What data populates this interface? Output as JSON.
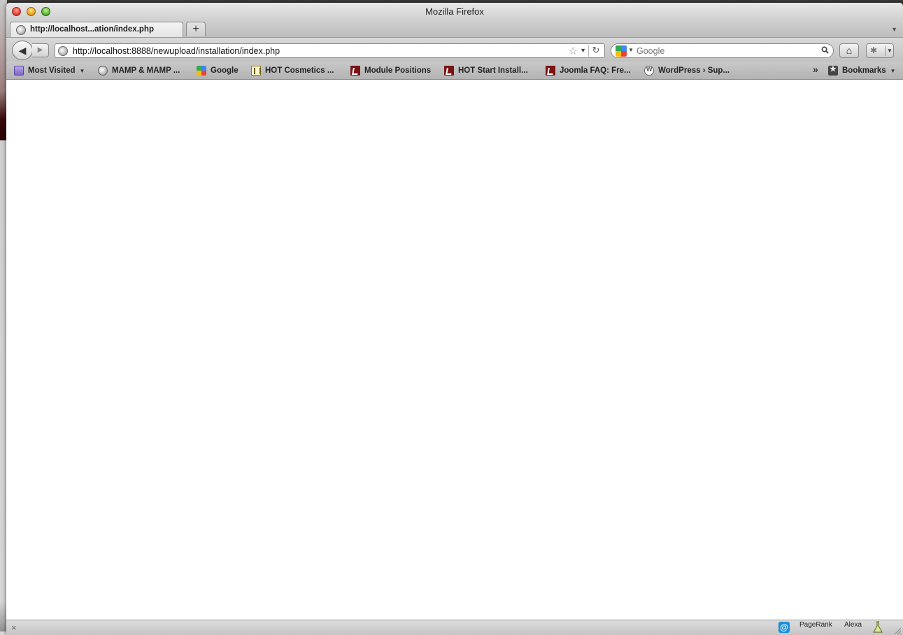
{
  "window": {
    "title": "Mozilla Firefox"
  },
  "tabs": [
    {
      "label": "http://localhost...ation/index.php",
      "active": true
    }
  ],
  "new_tab_label": "+",
  "navbar": {
    "back_glyph": "◀",
    "forward_glyph": "▶",
    "url": "http://localhost:8888/newupload/installation/index.php",
    "star_glyph": "☆",
    "dropdown_glyph": "▼",
    "reload_glyph": "↻",
    "search_placeholder": "Google",
    "home_glyph": "⌂",
    "addon_glyph": "✱"
  },
  "bookmarks": {
    "items": [
      {
        "label": "Most Visited",
        "icon": "folder-icon",
        "has_dropdown": true
      },
      {
        "label": "MAMP & MAMP ...",
        "icon": "globe-icon"
      },
      {
        "label": "Google",
        "icon": "google-icon"
      },
      {
        "label": "HOT Cosmetics ...",
        "icon": "hot-icon"
      },
      {
        "label": "Module Positions",
        "icon": "joomla-icon"
      },
      {
        "label": "HOT Start Install...",
        "icon": "joomla-icon"
      },
      {
        "label": "Joomla FAQ: Fre...",
        "icon": "joomla-icon"
      },
      {
        "label": "WordPress › Sup...",
        "icon": "wordpress-icon"
      }
    ],
    "overflow_glyph": "»",
    "bookmarks_menu_label": "Bookmarks"
  },
  "statusbar": {
    "close_glyph": "×",
    "addon_at_glyph": "@",
    "pagerank_label": "PageRank",
    "alexa_label": "Alexa"
  },
  "colors": {
    "close": "#e0443a",
    "minimize": "#e9a524",
    "maximize": "#5fb93a",
    "joomla": "#7a1414",
    "addon_blue": "#1a8fd6"
  }
}
